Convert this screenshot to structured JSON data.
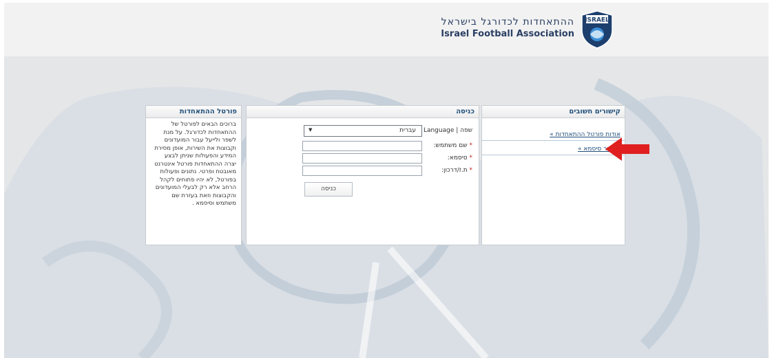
{
  "header": {
    "org_name_hebrew": "ההתאחדות לכדורגל בישראל",
    "org_name_english": "Israel Football Association",
    "logo_badge_text": "ISRAEL"
  },
  "links_panel": {
    "title": "קישורים חשובים",
    "items": [
      {
        "label": "אודות פורטל ההתאחדות »"
      },
      {
        "label": "שיחזור סיסמא »"
      }
    ]
  },
  "login_panel": {
    "title": "כניסה",
    "language_label": "שפה | Language :",
    "language_value": "עברית",
    "username_label": "שם משתמש:",
    "password_label": "סיסמא:",
    "id_label": "ת.ז/דרכון:",
    "required_mark": "*",
    "username_value": "",
    "password_value": "",
    "id_value": "",
    "submit_label": "כניסה"
  },
  "portal_panel": {
    "title": "פורטל ההתאחדות",
    "body": "ברוכים הבאים לפורטל של ההתאחדות לכדורגל. על מנת לשפר ולייעל עבור המועדונים וקבוצות את השירות, אופן מסירת המידע והפעולות שניתן לבצע יצרה ההתאחדות פורטל אינטרנט מאובטח ופרטי. נתונים ופעולות בפורטל, לא יהיו פתוחים לקהל הרחב אלא רק לבעלי המועדונים והקבוצות וזאת בעזרת שם משתמש וסיסמא ."
  },
  "colors": {
    "accent": "#1f4e7a",
    "arrow": "#e02020",
    "required": "#c81e1e"
  }
}
